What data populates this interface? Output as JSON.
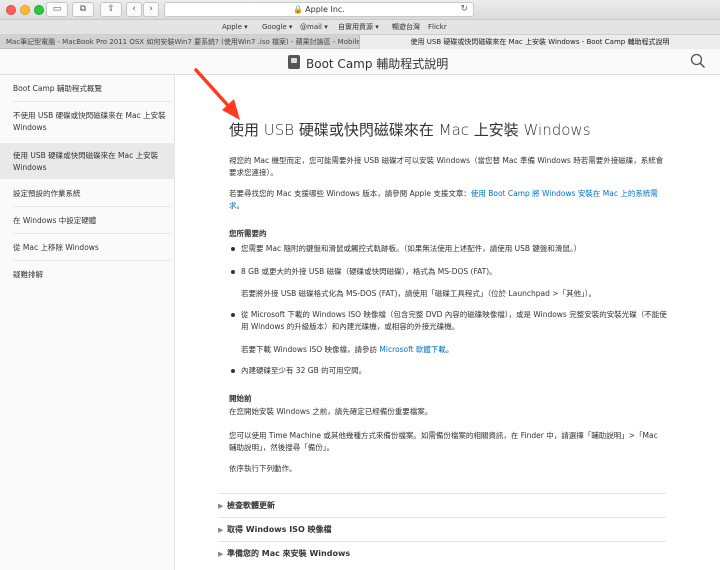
{
  "browser": {
    "address": "Apple Inc.",
    "favorites": [
      "Apple ▾",
      "Google ▾",
      "@mail ▾",
      "自實用資源 ▾",
      "暢遊台灣",
      "Flickr"
    ],
    "tabs": [
      {
        "title": "Mac筆記型電腦 - MacBook Pro 2011 OSX 如何安裝Win7 要系統? (使用Win7 .iso 檔案) - 蘋果討論區 - Mobile01"
      },
      {
        "title": "使用 USB 硬碟或快閃磁碟來在 Mac 上安裝 Windows - Boot Camp 輔助程式說明"
      }
    ]
  },
  "site": {
    "title": "Boot Camp 輔助程式說明"
  },
  "sidebar": {
    "items": [
      {
        "label": "Boot Camp 輔助程式概覽"
      },
      {
        "label": "不使用 USB 硬碟或快閃磁碟來在 Mac 上安裝 Windows"
      },
      {
        "label": "使用 USB 硬碟或快閃磁碟來在 Mac 上安裝 Windows"
      },
      {
        "label": "設定預設的作業系統"
      },
      {
        "label": "在 Windows 中設定硬體"
      },
      {
        "label": "從 Mac 上移除 Windows"
      },
      {
        "label": "疑難排解"
      }
    ]
  },
  "article": {
    "title": "使用 USB 硬碟或快閃磁碟來在 Mac 上安裝 Windows",
    "intro": "視您的 Mac 機型而定，您可能需要外接 USB 磁碟才可以安裝 Windows（當您替 Mac 準備 Windows 時若需要外接磁碟，系統會要求您連接）。",
    "support_prefix": "若要尋找您的 Mac 支援哪些 Windows 版本，請參閱 Apple 支援文章：",
    "support_link": "使用 Boot Camp 將 Windows 安裝在 Mac 上的系統需求",
    "support_suffix": "。",
    "needs_heading": "您所需要的",
    "needs": [
      "您需要 Mac 隨附的鍵盤和滑鼠或觸控式軌跡板。（如果無法使用上述配件，請使用 USB 鍵盤和滑鼠。）",
      "8 GB 或更大的外接 USB 磁碟（硬碟或快閃磁碟），格式為 MS-DOS (FAT)。",
      "從 Microsoft 下載的 Windows ISO 映像檔（包含完整 DVD 內容的磁碟映像檔），或是 Windows 完整安裝的安裝光碟（不能使用 Windows 的升級版本）和內建光碟機，或相容的外接光碟機。",
      "內建硬碟至少有 32 GB 的可用空間。"
    ],
    "format_note": "若要將外接 USB 磁碟格式化為 MS-DOS (FAT)，請使用「磁碟工具程式」（位於 Launchpad >「其他」）。",
    "iso_prefix": "若要下載 Windows ISO 映像檔，請參訪 ",
    "iso_link": "Microsoft 軟體下載",
    "iso_suffix": "。",
    "before_heading": "開始前",
    "before_text": "在您開始安裝 Windows 之前，請先確定已經備份重要檔案。",
    "backup_text": "您可以使用 Time Machine 或其他幾種方式來備份檔案。如需備份檔案的相關資訊，在 Finder 中，請選擇「輔助說明」>「Mac 輔助說明」，然後搜尋「備份」。",
    "steps_intro": "依序執行下列動作。",
    "accordions": [
      {
        "label": "檢查軟體更新"
      },
      {
        "label": "取得 Windows ISO 映像檔"
      },
      {
        "label": "準備您的 Mac 來安裝 Windows"
      }
    ]
  },
  "colors": {
    "link": "#0070c9",
    "arrow": "#ff3b1f",
    "sidebar_selected": "#e9e9e9"
  }
}
